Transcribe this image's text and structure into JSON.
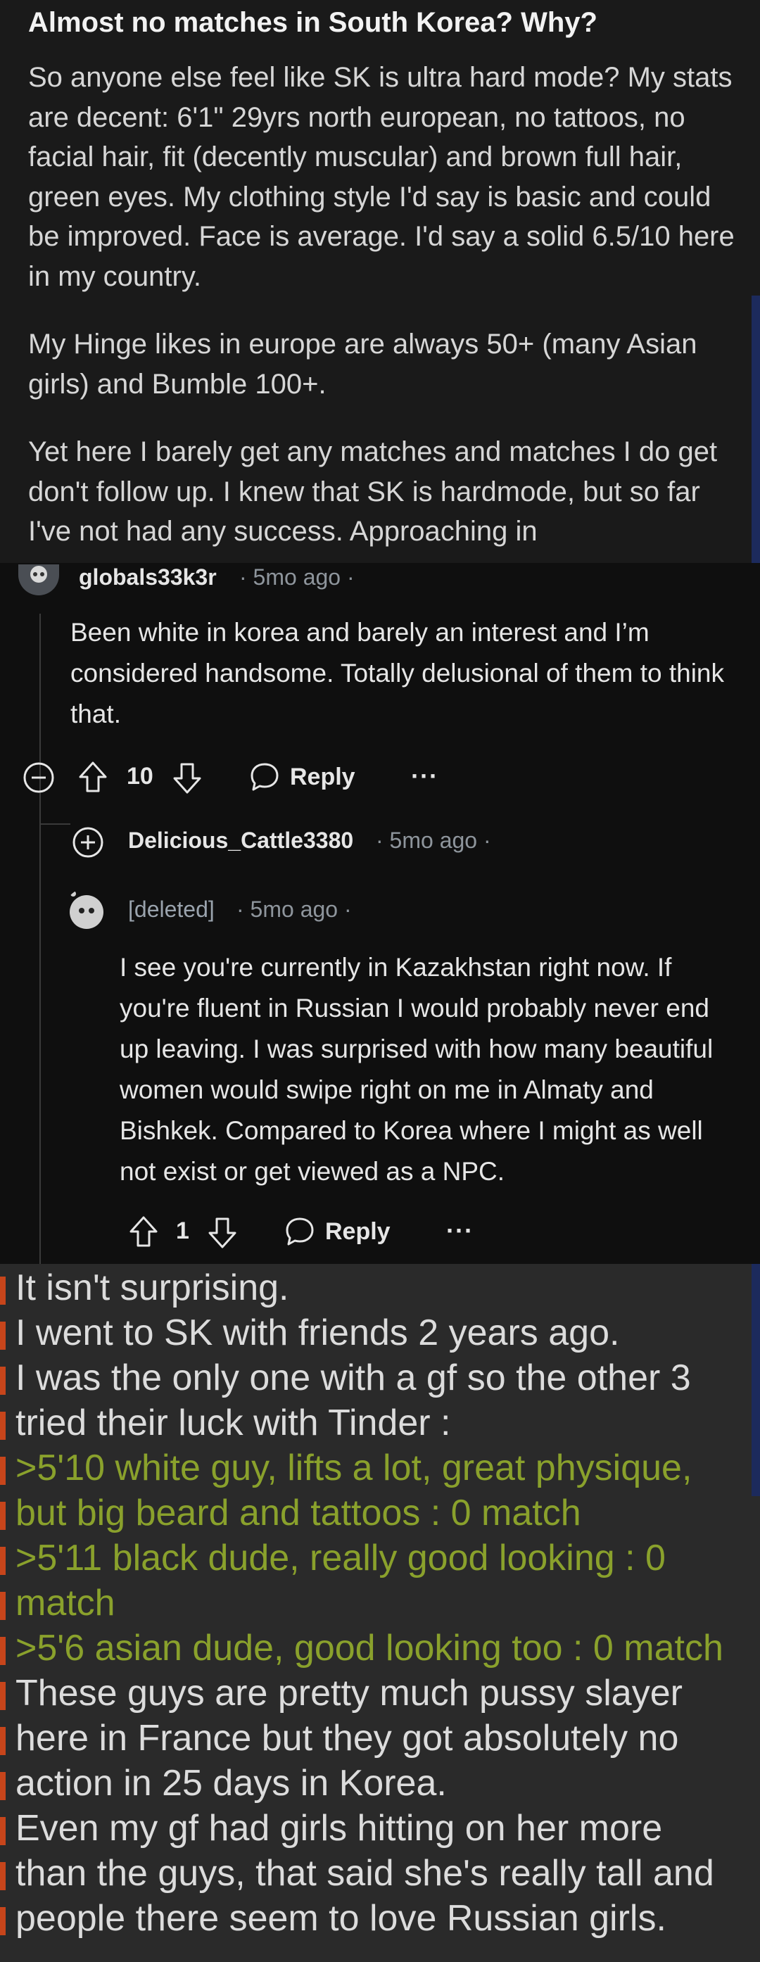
{
  "post": {
    "title": "Almost no matches in South Korea? Why?",
    "paragraphs": [
      "So anyone else feel like SK is ultra hard mode? My stats are decent: 6'1\" 29yrs north european, no tattoos, no facial hair, fit (decently muscular) and brown full hair, green eyes. My clothing style I'd say is basic and could be improved. Face is average. I'd say a solid 6.5/10 here in my country.",
      "My Hinge likes in europe are always 50+ (many Asian girls) and Bumble 100+.",
      "Yet here I barely get any matches and matches I do get don't follow up. I knew that SK is hardmode, but so far I've not had any success. Approaching in"
    ]
  },
  "comments": {
    "top": {
      "username": "globals33k3r",
      "meta": "· 5mo ago ·",
      "text": "Been white in korea and barely an interest and I’m considered handsome. Totally delusional of them to think that.",
      "votes": "10",
      "reply_label": "Reply",
      "more_label": "···"
    },
    "collapsed": {
      "username": "Delicious_Cattle3380",
      "meta": "· 5mo ago ·"
    },
    "deleted": {
      "username": "[deleted]",
      "meta": "· 5mo ago ·",
      "text": "I see you're currently in Kazakhstan right now. If you're fluent in Russian I would probably never end up leaving. I was surprised with how many beautiful women would swipe right on me in Almaty and Bishkek. Compared to Korea where I might as well not exist or get viewed as a NPC.",
      "votes": "1",
      "reply_label": "Reply",
      "more_label": "···"
    }
  },
  "greentext": {
    "lines": [
      {
        "text": "It isn't surprising.",
        "quote": false
      },
      {
        "text": "I went to SK with friends 2 years ago.",
        "quote": false
      },
      {
        "text": "I was the only one with a gf so the other 3",
        "quote": false
      },
      {
        "text": "tried their luck with Tinder :",
        "quote": false
      },
      {
        "text": ">5'10 white guy, lifts a lot, great physique,",
        "quote": true
      },
      {
        "text": "but big beard and tattoos : 0 match",
        "quote": true
      },
      {
        "text": ">5'11 black dude, really good looking : 0",
        "quote": true
      },
      {
        "text": "match",
        "quote": true
      },
      {
        "text": ">5'6 asian dude, good looking too : 0 match",
        "quote": true
      },
      {
        "text": "These guys are pretty much pussy slayer",
        "quote": false
      },
      {
        "text": "here in France but they got absolutely no",
        "quote": false
      },
      {
        "text": "action in 25 days in Korea.",
        "quote": false
      },
      {
        "text": "Even my gf had girls hitting on her more",
        "quote": false
      },
      {
        "text": "than the guys, that said she's really tall and",
        "quote": false
      },
      {
        "text": "people there seem to love Russian girls.",
        "quote": false
      }
    ]
  },
  "colors": {
    "greentext_quote": "#8aa12c",
    "accent_mark": "#c7451b"
  }
}
